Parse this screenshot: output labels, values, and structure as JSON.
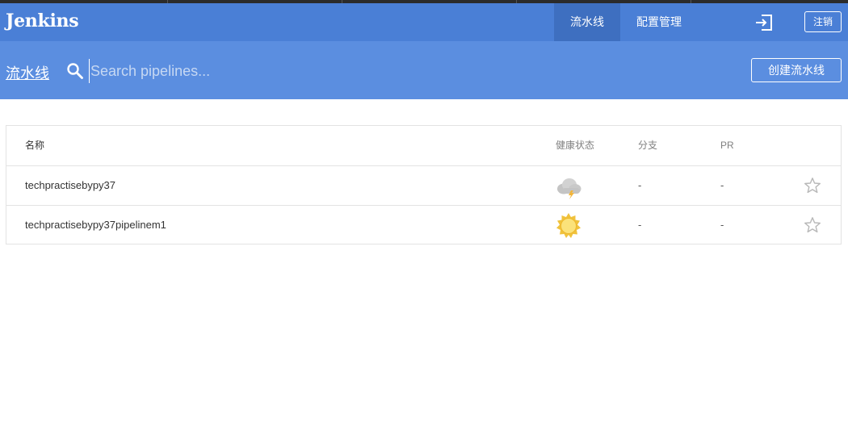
{
  "app": {
    "logo": "Jenkins"
  },
  "nav": {
    "pipelines_label": "流水线",
    "admin_label": "配置管理",
    "logout_label": "注销"
  },
  "subheader": {
    "title": "流水线",
    "search_placeholder": "Search pipelines...",
    "create_label": "创建流水线"
  },
  "table": {
    "headers": {
      "name": "名称",
      "health": "健康状态",
      "branches": "分支",
      "pr": "PR"
    },
    "rows": [
      {
        "name": "techpractisebypy37",
        "health_icon": "weather-storm-icon",
        "branches": "-",
        "pr": "-"
      },
      {
        "name": "techpractisebypy37pipelinem1",
        "health_icon": "weather-sunny-icon",
        "branches": "-",
        "pr": "-"
      }
    ]
  },
  "colors": {
    "header_bg": "#4a7fd6",
    "active_tab_bg": "#3e6fc0",
    "subheader_bg": "#5b8ee0",
    "border": "#e3e3e3"
  }
}
